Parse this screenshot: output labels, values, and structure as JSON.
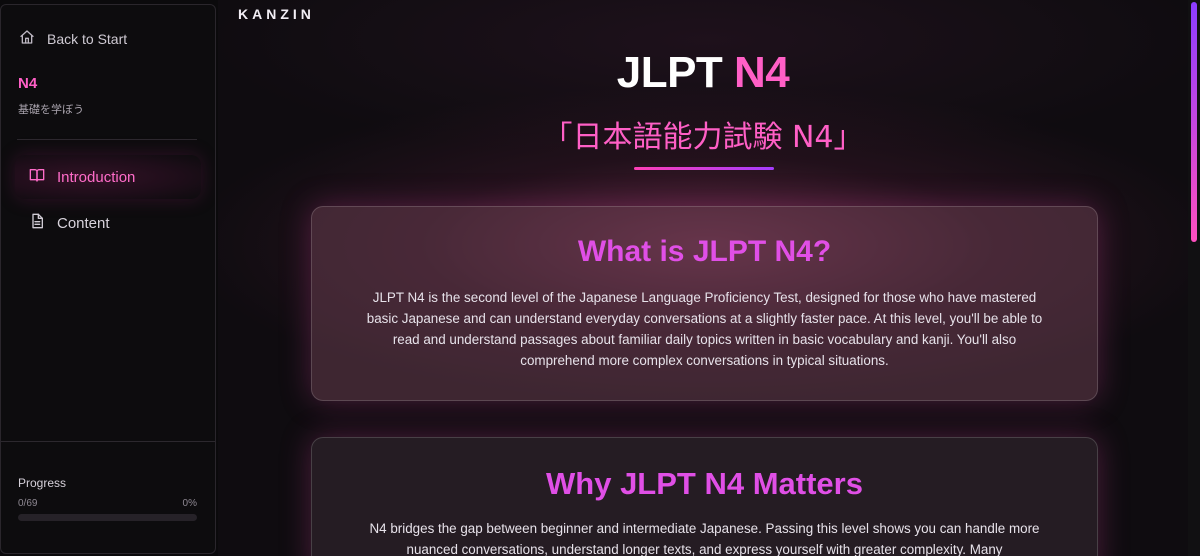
{
  "sidebar": {
    "back_label": "Back to Start",
    "level": "N4",
    "level_subtitle": "基礎を学ぼう",
    "nav": [
      {
        "label": "Introduction",
        "icon": "book-icon",
        "active": true
      },
      {
        "label": "Content",
        "icon": "document-icon",
        "active": false
      }
    ],
    "progress": {
      "label": "Progress",
      "count": "0/69",
      "percent_text": "0%",
      "value": 0
    }
  },
  "main": {
    "brand": "KANZIN",
    "hero": {
      "title_plain": "JLPT",
      "title_accent": "N4",
      "subtitle": "「日本語能力試験 N4」"
    },
    "sections": [
      {
        "heading": "What is JLPT N4?",
        "body": "JLPT N4 is the second level of the Japanese Language Proficiency Test, designed for those who have mastered basic Japanese and can understand everyday conversations at a slightly faster pace. At this level, you'll be able to read and understand passages about familiar daily topics written in basic vocabulary and kanji. You'll also comprehend more complex conversations in typical situations."
      },
      {
        "heading": "Why JLPT N4 Matters",
        "body": "N4 bridges the gap between beginner and intermediate Japanese. Passing this level shows you can handle more nuanced conversations, understand longer texts, and express yourself with greater complexity. Many"
      }
    ]
  },
  "colors": {
    "accent_pink": "#ff5fc6",
    "accent_purple": "#b23cff",
    "heading_magenta": "#e04fe6",
    "background": "#0f0c10"
  }
}
